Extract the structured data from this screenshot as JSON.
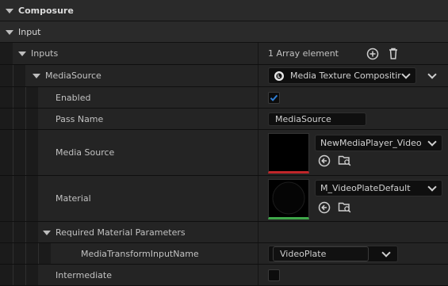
{
  "categories": {
    "composure": "Composure",
    "input": "Input"
  },
  "inputs": {
    "label": "Inputs",
    "count_text": "1 Array element"
  },
  "media_source_item": {
    "label": "MediaSource",
    "class_value": "Media Texture Compositir"
  },
  "properties": {
    "enabled": {
      "label": "Enabled",
      "checked": true
    },
    "pass_name": {
      "label": "Pass Name",
      "value": "MediaSource"
    },
    "media_source": {
      "label": "Media Source",
      "asset": "NewMediaPlayer_Video",
      "thumb_accent": "#c0262a"
    },
    "material": {
      "label": "Material",
      "asset": "M_VideoPlateDefault",
      "thumb_accent": "#3fa84a"
    },
    "required_params": {
      "label": "Required Material Parameters"
    },
    "media_transform": {
      "label": "MediaTransformInputName",
      "value": "VideoPlate"
    },
    "intermediate": {
      "label": "Intermediate",
      "checked": false
    }
  },
  "icons": {
    "add": "plus-circle-icon",
    "delete": "trash-icon",
    "class": "unreal-logo-icon",
    "use_selected": "arrow-left-circle-icon",
    "browse": "folder-search-icon"
  },
  "colors": {
    "checkbox_accent": "#2f7fd6"
  }
}
